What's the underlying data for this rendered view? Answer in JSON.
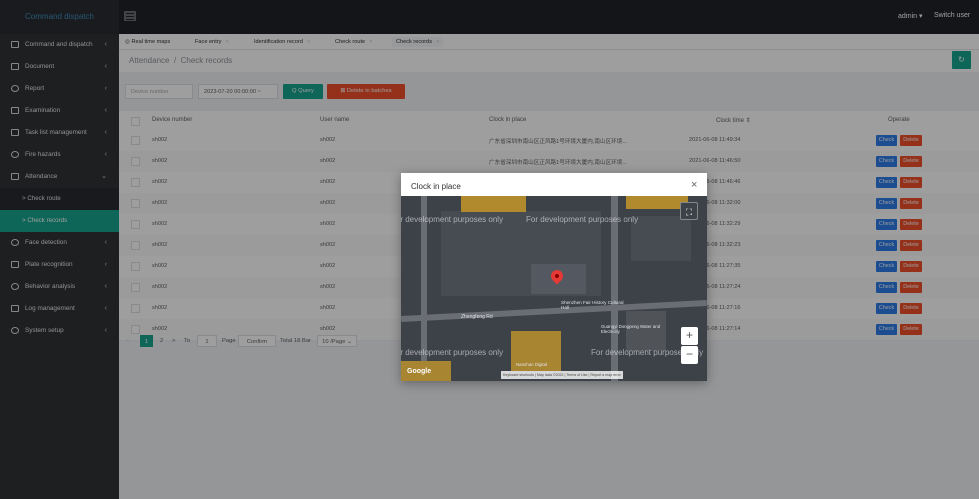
{
  "app": {
    "brand": "Command dispatch"
  },
  "header": {
    "user": "admin",
    "switch_user": "Switch user"
  },
  "sidebar": {
    "items": [
      {
        "label": "Command and dispatch",
        "icon": "monitor-icon"
      },
      {
        "label": "Document",
        "icon": "document-icon"
      },
      {
        "label": "Report",
        "icon": "report-icon"
      },
      {
        "label": "Examination",
        "icon": "exam-icon"
      },
      {
        "label": "Task list management",
        "icon": "task-icon"
      },
      {
        "label": "Fire hazards",
        "icon": "fire-icon"
      },
      {
        "label": "Attendance",
        "icon": "attendance-icon"
      }
    ],
    "attendance_sub": [
      {
        "label": "> Check route"
      },
      {
        "label": "> Check records"
      }
    ],
    "items_after": [
      {
        "label": "Face detection",
        "icon": "face-icon"
      },
      {
        "label": "Plate recognition",
        "icon": "plate-icon"
      },
      {
        "label": "Behavior analysis",
        "icon": "behavior-icon"
      },
      {
        "label": "Log management",
        "icon": "log-icon"
      },
      {
        "label": "System setup",
        "icon": "settings-icon"
      }
    ]
  },
  "tabs": [
    {
      "label": "Real time maps"
    },
    {
      "label": "Face entry"
    },
    {
      "label": "Identification record"
    },
    {
      "label": "Check route"
    },
    {
      "label": "Check records"
    }
  ],
  "breadcrumb": {
    "parent": "Attendance",
    "current": "Check records"
  },
  "toolbar": {
    "device_placeholder": "Device number",
    "date_value": "2023-07-20 00:00:00 ~",
    "query_label": "Q Query",
    "delete_batch_label": "Delete in batches"
  },
  "table": {
    "headers": [
      "Device number",
      "User name",
      "Clock in place",
      "Clock time",
      "Operate"
    ],
    "rows": [
      {
        "device": "sh002",
        "user": "sh002",
        "place": "广东省深圳市南山区正风路1号环境大厦内,南山区环境...",
        "time": "2021-06-08 11:49:34"
      },
      {
        "device": "sh002",
        "user": "sh002",
        "place": "广东省深圳市南山区正风路1号环境大厦内,南山区环境...",
        "time": "2021-06-08 11:46:50"
      },
      {
        "device": "sh002",
        "user": "sh002",
        "place": "",
        "time": "2021-06-08 11:46:46"
      },
      {
        "device": "sh002",
        "user": "sh002",
        "place": "",
        "time": "2021-06-08 11:32:00"
      },
      {
        "device": "sh002",
        "user": "sh002",
        "place": "",
        "time": "2021-06-08 11:32:29"
      },
      {
        "device": "sh002",
        "user": "sh002",
        "place": "",
        "time": "2021-06-08 11:32:23"
      },
      {
        "device": "sh002",
        "user": "sh002",
        "place": "",
        "time": "2021-06-08 11:27:35"
      },
      {
        "device": "sh002",
        "user": "sh002",
        "place": "",
        "time": "2021-06-08 11:27:24"
      },
      {
        "device": "sh002",
        "user": "sh002",
        "place": "",
        "time": "2021-06-08 11:27:16"
      },
      {
        "device": "sh002",
        "user": "sh002",
        "place": "",
        "time": "2021-06-08 11:27:14"
      }
    ],
    "check_label": "Check",
    "delete_label": "Delete"
  },
  "pagination": {
    "page1": "1",
    "page2": "2",
    "next": ">",
    "to_label": "To",
    "page_input": "1",
    "page_label": "Page",
    "confirm": "Confirm",
    "total": "Total 18 Bar",
    "per_page": "10 /Page"
  },
  "modal": {
    "title": "Clock in place",
    "watermark": "For development purposes only",
    "map_labels": [
      "Shenzhen Fair History Cultural Hall",
      "Zhengfeng Rd",
      "Guangyi Dongpeng Water and Electricity",
      "Nanshan Digital"
    ],
    "attribution": "Keyboard shortcuts | Map data ©2022 | Terms of Use | Report a map error"
  },
  "colors": {
    "accent": "#18a58e",
    "danger": "#f0502d",
    "check": "#2d7ce8"
  }
}
